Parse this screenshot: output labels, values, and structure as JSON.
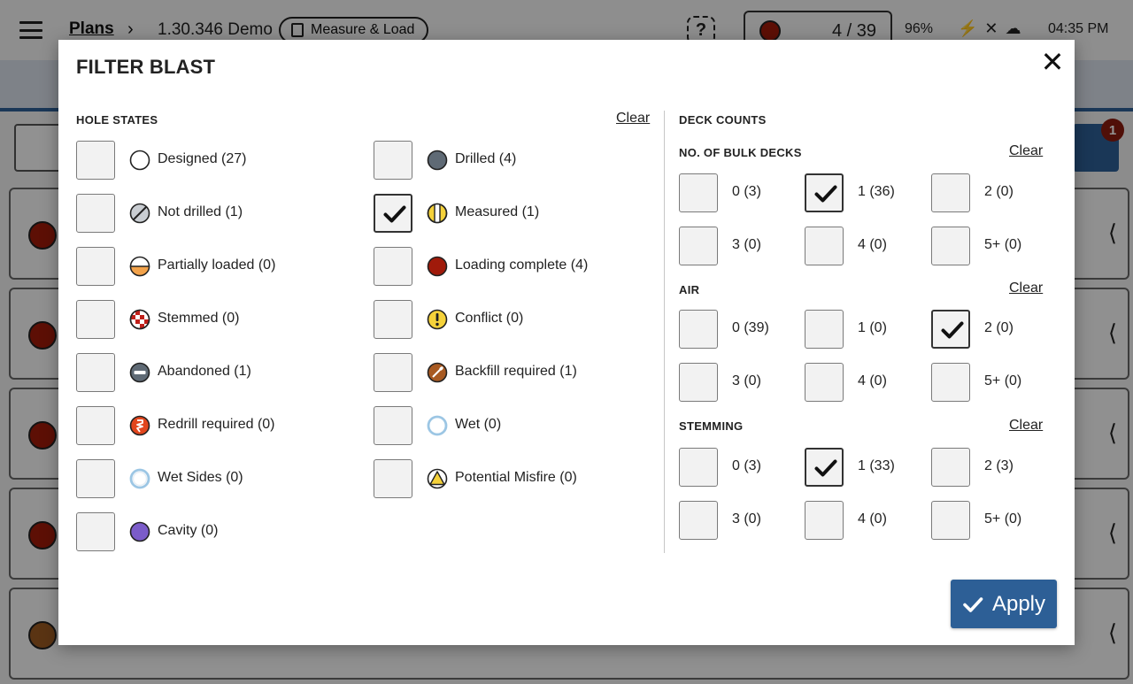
{
  "app": {
    "breadcrumb": {
      "plans": "Plans",
      "separator": "›",
      "project": "1.30.346 Demo"
    },
    "mode": "Measure & Load",
    "counter": "4 / 39",
    "battery": "96%",
    "clock": "04:35 PM",
    "notification_count": "1"
  },
  "modal": {
    "title": "FILTER BLAST",
    "close_icon": "close-icon",
    "hole_states": {
      "label": "HOLE STATES",
      "clear": "Clear",
      "items": [
        {
          "label": "Designed (27)",
          "icon": "designed-icon",
          "checked": false
        },
        {
          "label": "Drilled (4)",
          "icon": "drilled-icon",
          "checked": false
        },
        {
          "label": "Not drilled (1)",
          "icon": "not-drilled-icon",
          "checked": false
        },
        {
          "label": "Measured (1)",
          "icon": "measured-icon",
          "checked": true
        },
        {
          "label": "Partially loaded (0)",
          "icon": "partially-loaded-icon",
          "checked": false
        },
        {
          "label": "Loading complete (4)",
          "icon": "loading-complete-icon",
          "checked": false
        },
        {
          "label": "Stemmed (0)",
          "icon": "stemmed-icon",
          "checked": false
        },
        {
          "label": "Conflict (0)",
          "icon": "conflict-icon",
          "checked": false
        },
        {
          "label": "Abandoned (1)",
          "icon": "abandoned-icon",
          "checked": false
        },
        {
          "label": "Backfill required (1)",
          "icon": "backfill-required-icon",
          "checked": false
        },
        {
          "label": "Redrill required (0)",
          "icon": "redrill-required-icon",
          "checked": false
        },
        {
          "label": "Wet (0)",
          "icon": "wet-icon",
          "checked": false
        },
        {
          "label": "Wet Sides (0)",
          "icon": "wet-sides-icon",
          "checked": false
        },
        {
          "label": "Potential Misfire (0)",
          "icon": "potential-misfire-icon",
          "checked": false
        },
        {
          "label": "Cavity (0)",
          "icon": "cavity-icon",
          "checked": false
        }
      ]
    },
    "deck_counts": {
      "label": "DECK COUNTS",
      "bulk_decks": {
        "label": "NO. OF BULK DECKS",
        "clear": "Clear",
        "options": [
          {
            "label": "0 (3)",
            "checked": false
          },
          {
            "label": "1 (36)",
            "checked": true
          },
          {
            "label": "2 (0)",
            "checked": false
          },
          {
            "label": "3 (0)",
            "checked": false
          },
          {
            "label": "4 (0)",
            "checked": false
          },
          {
            "label": "5+ (0)",
            "checked": false
          }
        ]
      },
      "air": {
        "label": "AIR",
        "clear": "Clear",
        "options": [
          {
            "label": "0 (39)",
            "checked": false
          },
          {
            "label": "1 (0)",
            "checked": false
          },
          {
            "label": "2 (0)",
            "checked": true
          },
          {
            "label": "3 (0)",
            "checked": false
          },
          {
            "label": "4 (0)",
            "checked": false
          },
          {
            "label": "5+ (0)",
            "checked": false
          }
        ]
      },
      "stemming": {
        "label": "STEMMING",
        "clear": "Clear",
        "options": [
          {
            "label": "0 (3)",
            "checked": false
          },
          {
            "label": "1 (33)",
            "checked": true
          },
          {
            "label": "2 (3)",
            "checked": false
          },
          {
            "label": "3 (0)",
            "checked": false
          },
          {
            "label": "4 (0)",
            "checked": false
          },
          {
            "label": "5+ (0)",
            "checked": false
          }
        ]
      }
    },
    "apply": {
      "label": "Apply",
      "icon": "check-icon"
    }
  },
  "colors": {
    "primary": "#2d5f96",
    "loading_complete": "#a01a0a",
    "drilled": "#5f6a75",
    "cavity": "#7b5cc9",
    "conflict": "#f5d23a",
    "redrill": "#e2461d",
    "backfill": "#a85a22",
    "partial": "#f2a24a",
    "wet": "#9cc6e4"
  }
}
